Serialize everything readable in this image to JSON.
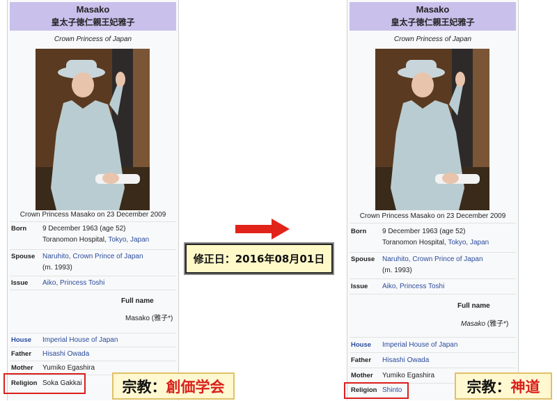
{
  "left": {
    "name_en": "Masako",
    "name_jp": "皇太子徳仁親王妃雅子",
    "title": "Crown Princess of Japan",
    "photo_caption": "Crown Princess Masako on 23 December 2009",
    "born_label": "Born",
    "born_line1": "9 December 1963 (age 52)",
    "born_line2_plain": "Toranomon Hospital, ",
    "born_line2_link": "Tokyo, Japan",
    "spouse_label": "Spouse",
    "spouse_link": "Naruhito, Crown Prince of Japan",
    "spouse_year": "(m. 1993)",
    "issue_label": "Issue",
    "issue_link": "Aiko, Princess Toshi",
    "fullname_label": "Full name",
    "fullname_value": "Masako (雅子*)",
    "house_label": "House",
    "house_link": "Imperial House of Japan",
    "father_label": "Father",
    "father_link": "Hisashi Owada",
    "mother_label": "Mother",
    "mother_value": "Yumiko Egashira",
    "religion_label": "Religion",
    "religion_value": "Soka Gakkai"
  },
  "right": {
    "name_en": "Masako",
    "name_jp": "皇太子徳仁親王妃雅子",
    "title": "Crown Princess of Japan",
    "photo_caption": "Crown Princess Masako on 23 December 2009",
    "born_label": "Born",
    "born_line1": "9 December 1963 (age 52)",
    "born_line2_plain": "Toranomon Hospital, ",
    "born_line2_link": "Tokyo, Japan",
    "spouse_label": "Spouse",
    "spouse_link": "Naruhito, Crown Prince of Japan",
    "spouse_year": "(m. 1993)",
    "issue_label": "Issue",
    "issue_link": "Aiko, Princess Toshi",
    "fullname_label": "Full name",
    "fullname_value_italic": "Masako",
    "fullname_value_rest": " (雅子*)",
    "house_label": "House",
    "house_link": "Imperial House of Japan",
    "father_label": "Father",
    "father_link": "Hisashi Owada",
    "mother_label": "Mother",
    "mother_value": "Yumiko Egashira",
    "religion_label": "Religion",
    "religion_value": "Shinto"
  },
  "date_label": "修正日：2016年08月01日",
  "tag_left": {
    "key": "宗教：",
    "value": "創価学会"
  },
  "tag_right": {
    "key": "宗教：",
    "value": "神道"
  },
  "colors": {
    "header": "#c9c0ec",
    "link": "#2a4b9b",
    "highlight": "#d9201c",
    "tag_bg": "#fff8d0",
    "date_bg": "#fff9c8"
  }
}
